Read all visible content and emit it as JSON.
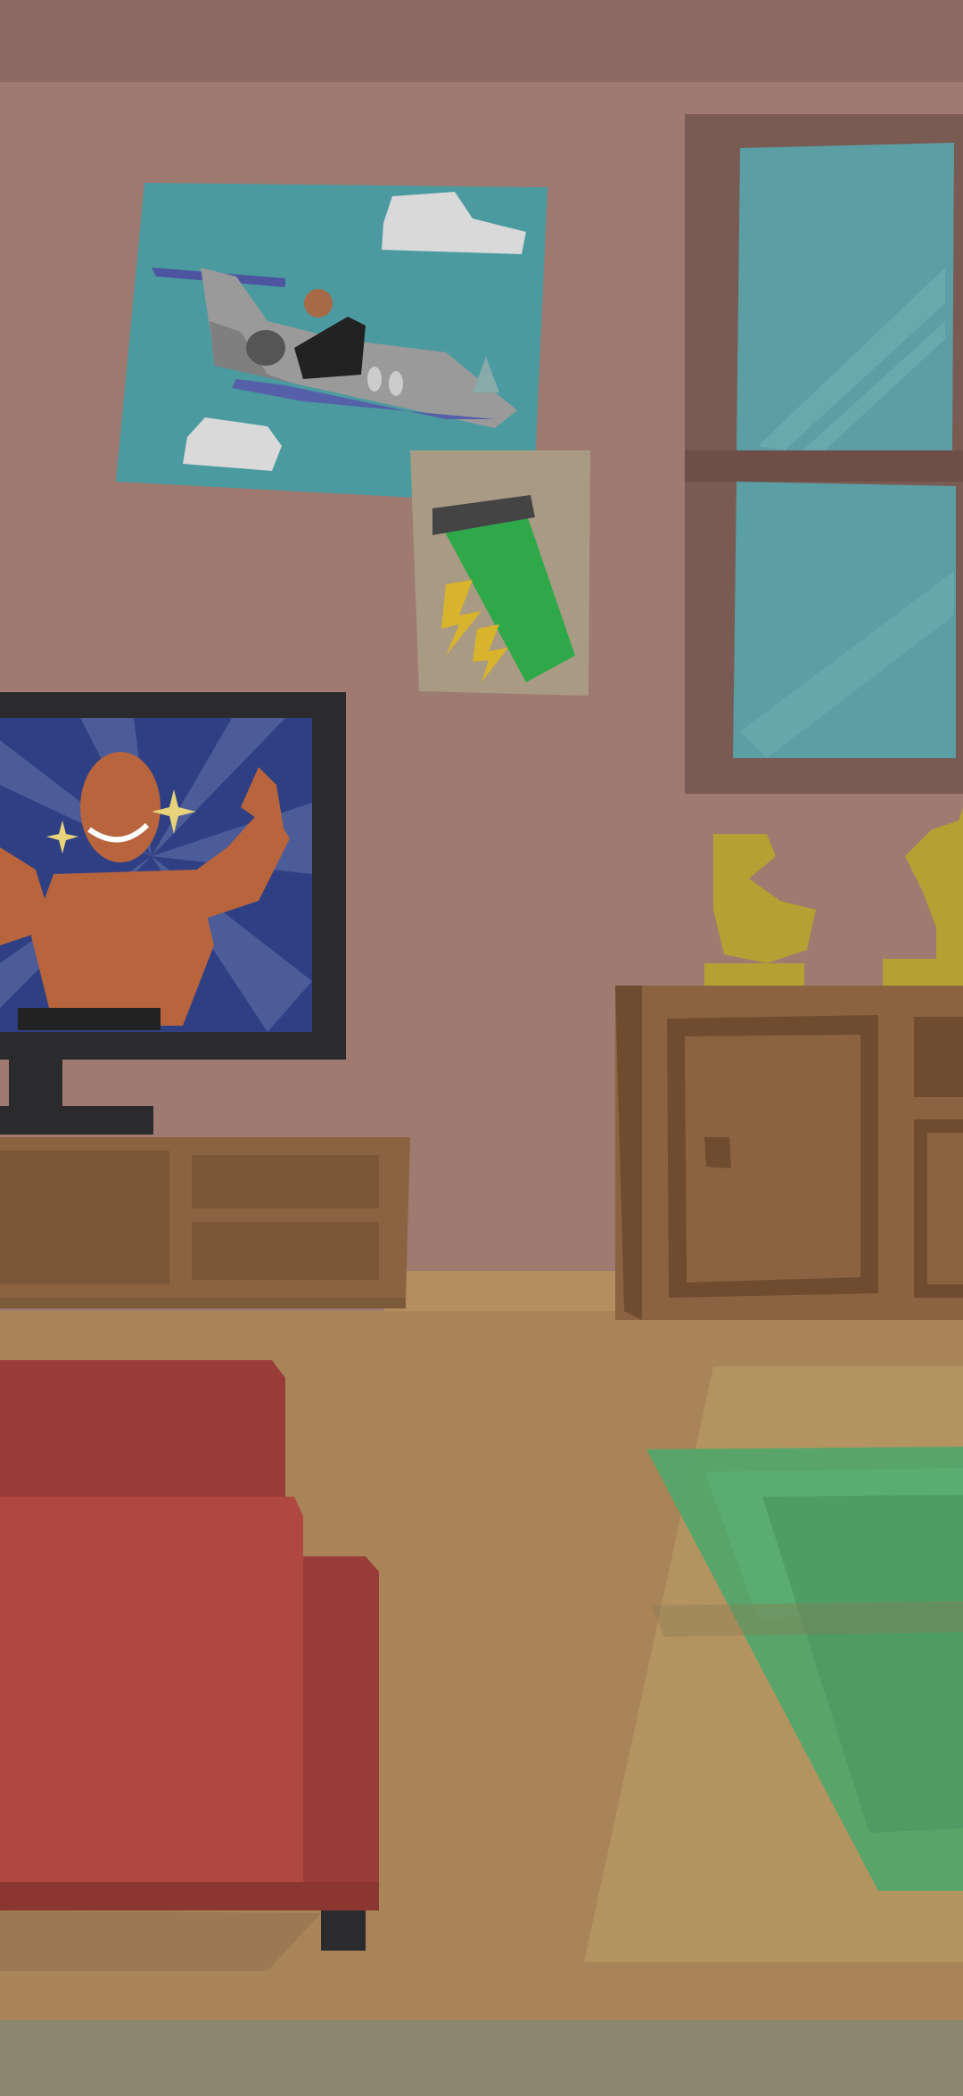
{
  "scene": {
    "name": "living-room",
    "colors": {
      "ceiling": "#8a6a62",
      "wall": "#9e7a71",
      "floor": "#a98459",
      "floor_trim": "#8a8670",
      "wood": "#8b6340",
      "wood_dark": "#6f4c30",
      "sofa": "#b04842",
      "sofa_dark": "#9a3c37",
      "rug": "#b39460",
      "table_glass": "#4fa66a",
      "window_glass": "#5b9ea3",
      "window_frame": "#7a5b53",
      "trophy": "#b4a033",
      "tv_frame": "#2b2b2d",
      "poster_sky": "#4a9aa0",
      "can_green": "#2fa84a",
      "can_bolt": "#d8b32c"
    },
    "objects": {
      "poster_label": "",
      "tv_show": "",
      "trophies": [
        "biceps-trophy",
        "bodybuilder-trophy"
      ]
    }
  }
}
